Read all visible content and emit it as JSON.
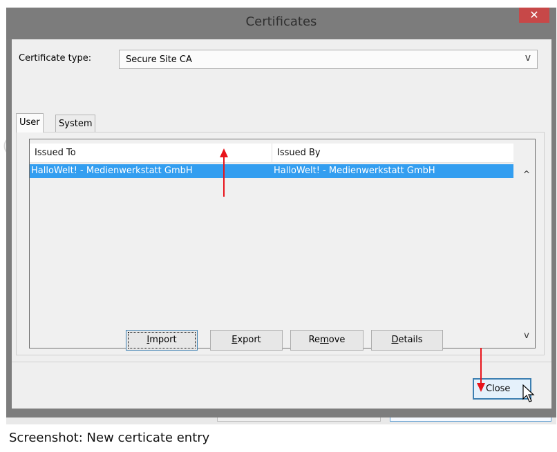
{
  "window": {
    "title": "Certificates",
    "close_glyph": "✕"
  },
  "form": {
    "cert_type_label": "Certificate type:",
    "cert_type_value": "Secure Site CA",
    "combo_arrow": "v"
  },
  "tabs": [
    {
      "label": "User",
      "active": true
    },
    {
      "label": "System",
      "active": false
    }
  ],
  "table": {
    "columns": [
      "Issued To",
      "Issued By"
    ],
    "rows": [
      {
        "issued_to": "HalloWelt! - Medienwerkstatt GmbH",
        "issued_by": "HalloWelt! - Medienwerkstatt GmbH",
        "selected": true
      }
    ],
    "scroll_up": "^",
    "scroll_down": "v"
  },
  "buttons": {
    "import": {
      "pre": "",
      "key": "I",
      "post": "mport"
    },
    "export": {
      "pre": "",
      "key": "E",
      "post": "xport"
    },
    "remove": {
      "pre": "Re",
      "key": "m",
      "post": "ove"
    },
    "details": {
      "pre": "",
      "key": "D",
      "post": "etails"
    },
    "close": "Close"
  },
  "annotations": {
    "arrow_color": "#e8141b"
  },
  "caption": "Screenshot: New certicate entry"
}
